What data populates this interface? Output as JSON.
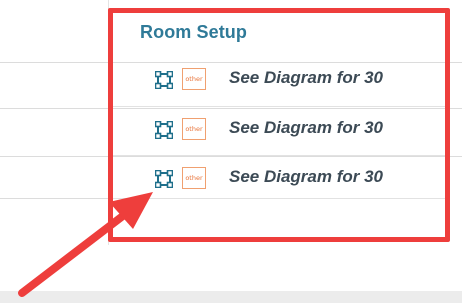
{
  "panel": {
    "title": "Room Setup",
    "rows": [
      {
        "badge": "other",
        "label": "See Diagram for 30",
        "icon": "crop-frame-icon"
      },
      {
        "badge": "other",
        "label": "See Diagram for 30",
        "icon": "crop-frame-icon"
      },
      {
        "badge": "other",
        "label": "See Diagram for 30",
        "icon": "crop-frame-icon"
      }
    ]
  },
  "colors": {
    "highlight": "#ee3e3c",
    "title": "#2f7a98",
    "badge_border": "#f0a070",
    "badge_text": "#e8743a",
    "icon": "#1f6f8b",
    "label": "#3c4a55"
  }
}
